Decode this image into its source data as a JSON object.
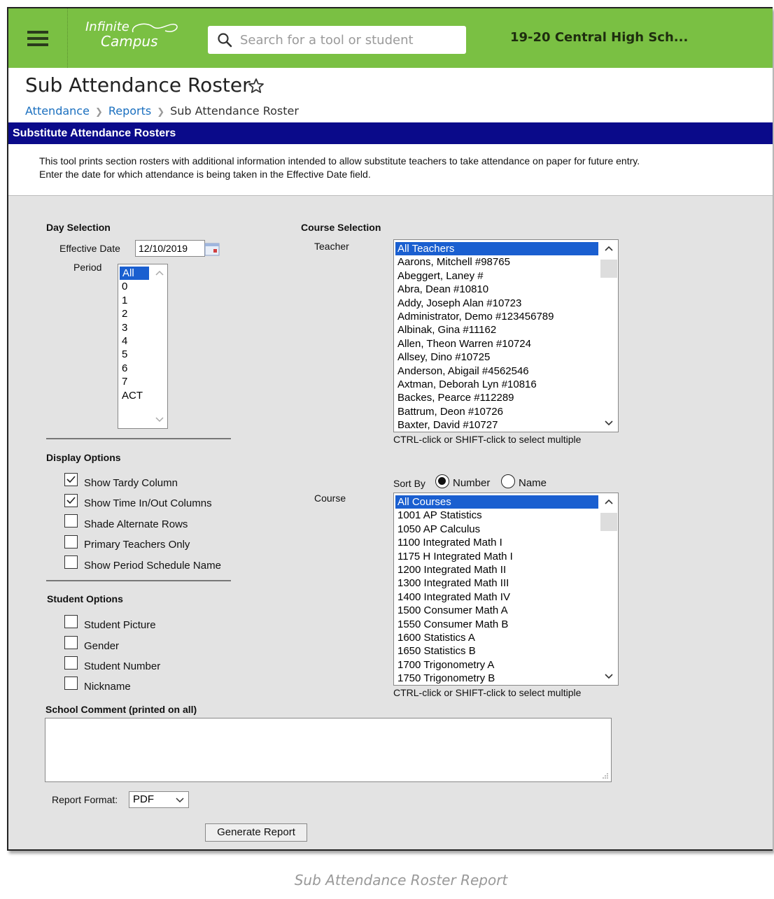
{
  "app": {
    "logo_line1": "Infinite",
    "logo_line2": "Campus"
  },
  "search": {
    "placeholder": "Search for a tool or student"
  },
  "school_label": "19-20 Central High Sch...",
  "page": {
    "title": "Sub Attendance Roster"
  },
  "breadcrumb": [
    "Attendance",
    "Reports",
    "Sub Attendance Roster"
  ],
  "panel": {
    "title": "Substitute Attendance Rosters",
    "desc_line1": "This tool prints section rosters with additional information intended to allow substitute teachers to take attendance on paper for future entry.",
    "desc_line2": "Enter the date for which attendance is being taken in the Effective Date field."
  },
  "day_selection": {
    "heading": "Day Selection",
    "effective_date_label": "Effective Date",
    "effective_date_value": "12/10/2019",
    "period_label": "Period",
    "periods": [
      "All",
      "0",
      "1",
      "2",
      "3",
      "4",
      "5",
      "6",
      "7",
      "ACT"
    ]
  },
  "display_options": {
    "heading": "Display Options",
    "items": [
      {
        "label": "Show Tardy Column",
        "checked": true
      },
      {
        "label": "Show Time In/Out Columns",
        "checked": true
      },
      {
        "label": "Shade Alternate Rows",
        "checked": false
      },
      {
        "label": "Primary Teachers Only",
        "checked": false
      },
      {
        "label": "Show Period Schedule Name",
        "checked": false
      }
    ]
  },
  "student_options": {
    "heading": "Student Options",
    "items": [
      {
        "label": "Student Picture",
        "checked": false
      },
      {
        "label": "Gender",
        "checked": false
      },
      {
        "label": "Student Number",
        "checked": false
      },
      {
        "label": "Nickname",
        "checked": false
      }
    ]
  },
  "course_selection": {
    "heading": "Course Selection",
    "teacher_label": "Teacher",
    "teachers": [
      "All Teachers",
      "Aarons, Mitchell #98765",
      "Abeggert, Laney #",
      "Abra, Dean #10810",
      "Addy, Joseph Alan #10723",
      "Administrator, Demo #123456789",
      "Albinak, Gina #11162",
      "Allen, Theon Warren #10724",
      "Allsey, Dino #10725",
      "Anderson, Abigail #4562546",
      "Axtman, Deborah Lyn #10816",
      "Backes, Pearce #112289",
      "Battrum, Deon #10726",
      "Baxter, David #10727"
    ],
    "hint": "CTRL-click or SHIFT-click to select multiple",
    "sort_by_label": "Sort By",
    "sort_number": "Number",
    "sort_name": "Name",
    "course_label": "Course",
    "courses": [
      "All Courses",
      "1001 AP Statistics",
      "1050 AP Calculus",
      "1100 Integrated Math I",
      "1175 H Integrated Math I",
      "1200 Integrated Math II",
      "1300 Integrated Math III",
      "1400 Integrated Math IV",
      "1500 Consumer Math A",
      "1550 Consumer Math B",
      "1600 Statistics A",
      "1650 Statistics B",
      "1700 Trigonometry A",
      "1750 Trigonometry B"
    ]
  },
  "comment": {
    "label": "School Comment (printed on all)"
  },
  "report_format": {
    "label": "Report Format:",
    "value": "PDF"
  },
  "generate_button": "Generate Report",
  "caption": "Sub Attendance Roster Report"
}
